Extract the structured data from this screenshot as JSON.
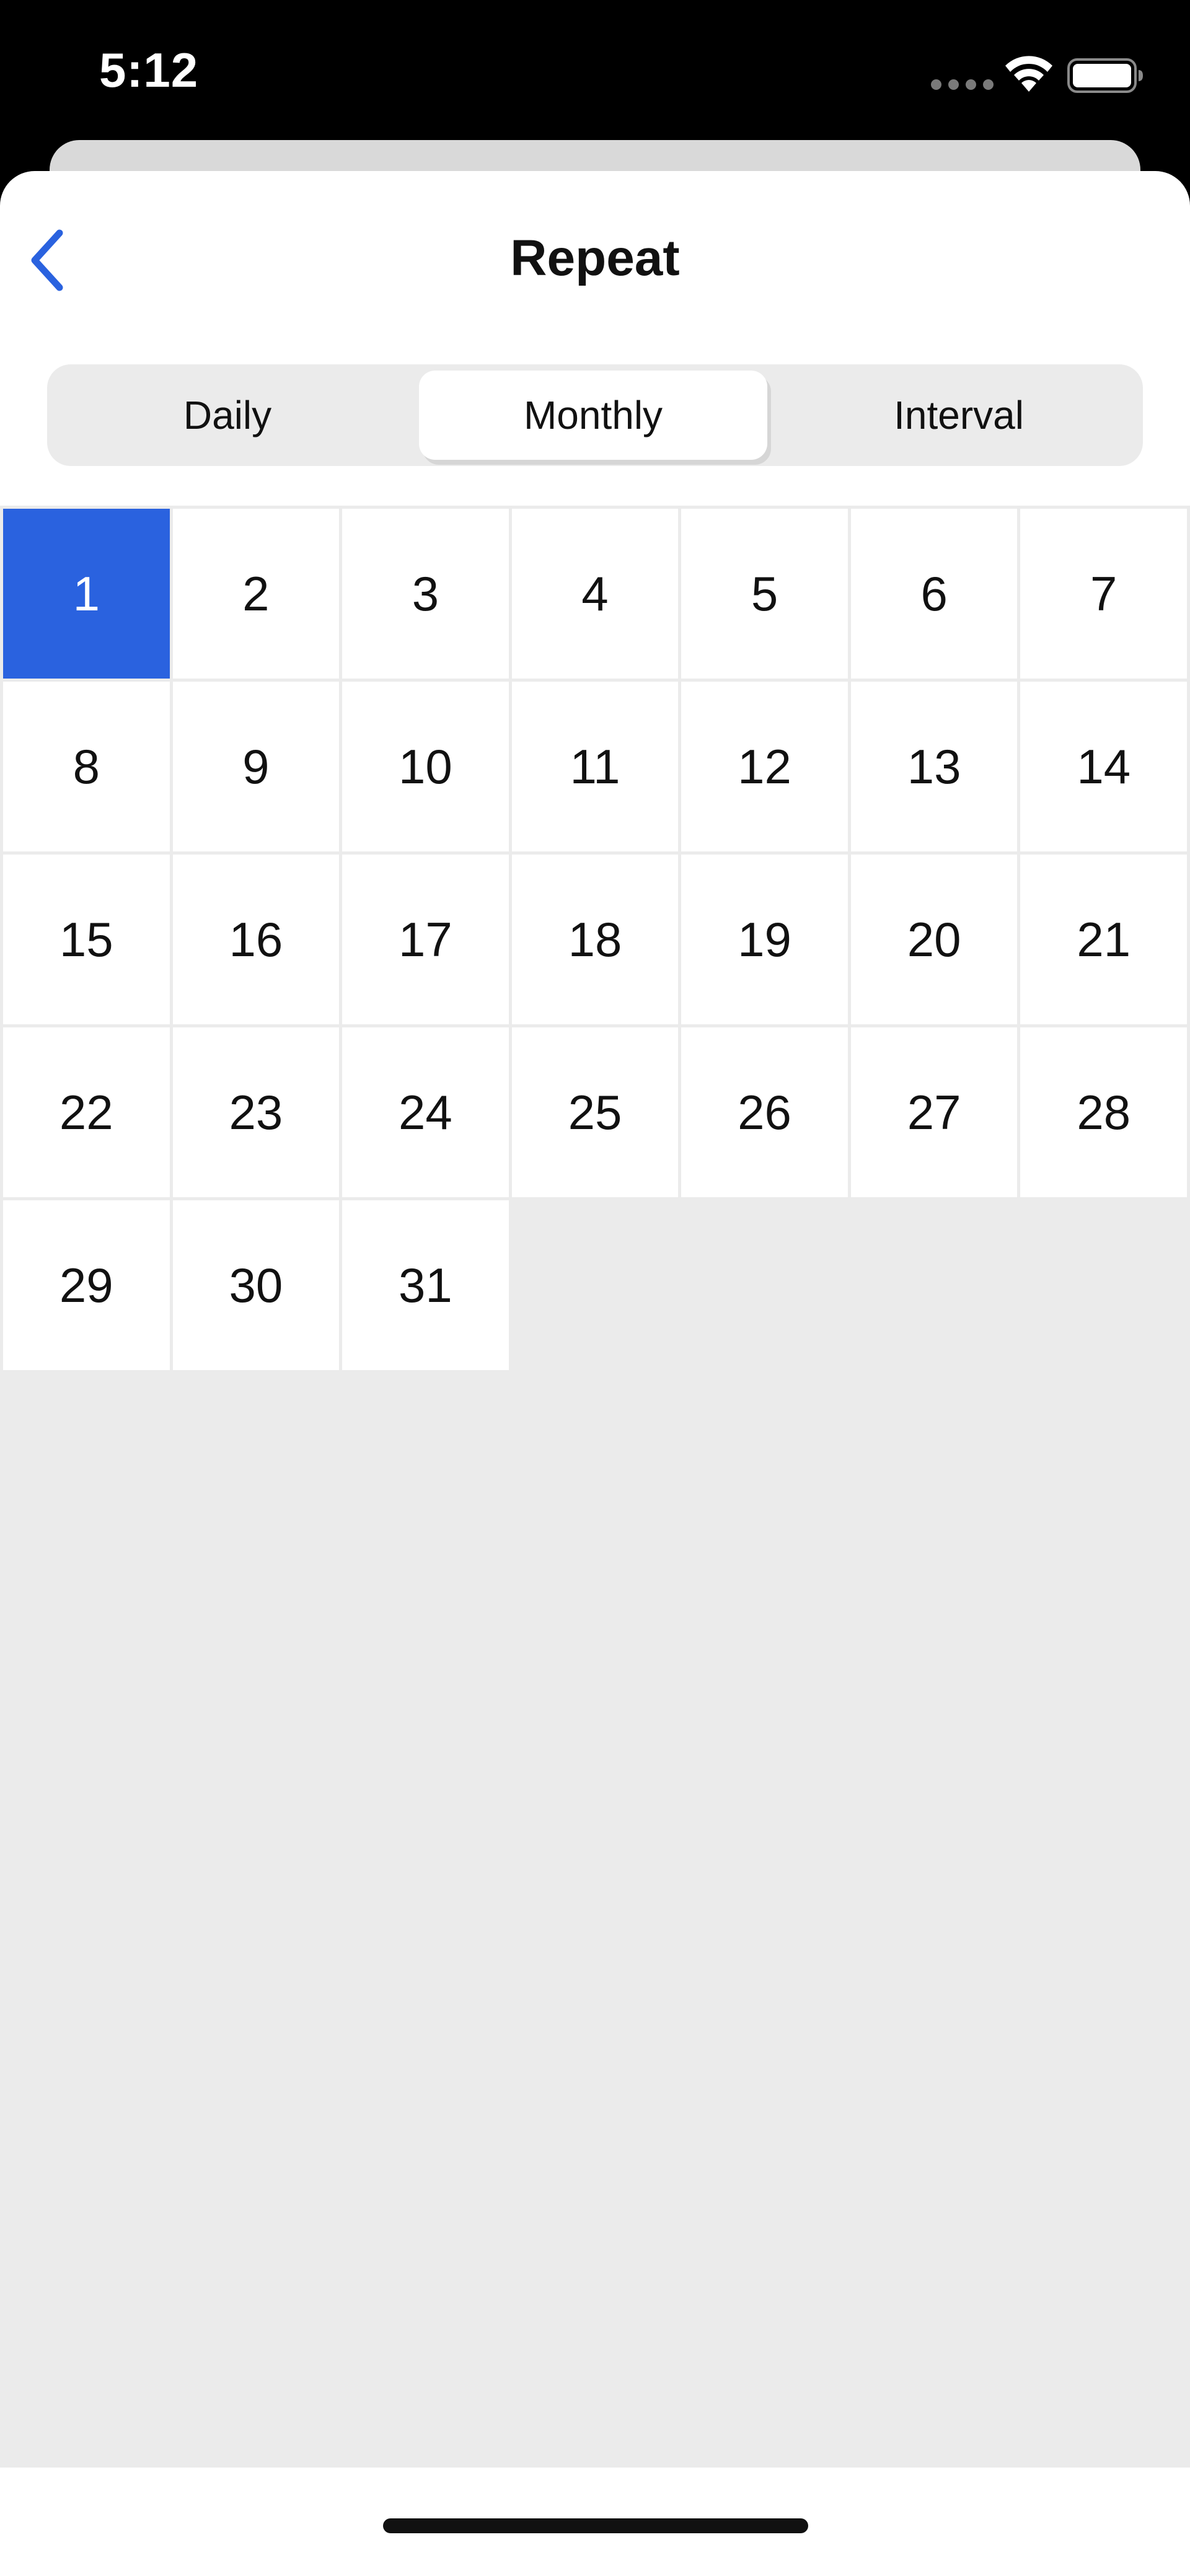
{
  "status_bar": {
    "time": "5:12"
  },
  "header": {
    "title": "Repeat",
    "back_icon": "chevron-left-icon"
  },
  "tabs": [
    {
      "label": "Daily",
      "selected": false
    },
    {
      "label": "Monthly",
      "selected": true
    },
    {
      "label": "Interval",
      "selected": false
    }
  ],
  "calendar": {
    "selected_day": 1,
    "days": [
      "1",
      "2",
      "3",
      "4",
      "5",
      "6",
      "7",
      "8",
      "9",
      "10",
      "11",
      "12",
      "13",
      "14",
      "15",
      "16",
      "17",
      "18",
      "19",
      "20",
      "21",
      "22",
      "23",
      "24",
      "25",
      "26",
      "27",
      "28",
      "29",
      "30",
      "31"
    ]
  },
  "colors": {
    "accent": "#2a62df",
    "grid_background": "#ebebeb",
    "sheet_background": "#ffffff"
  }
}
